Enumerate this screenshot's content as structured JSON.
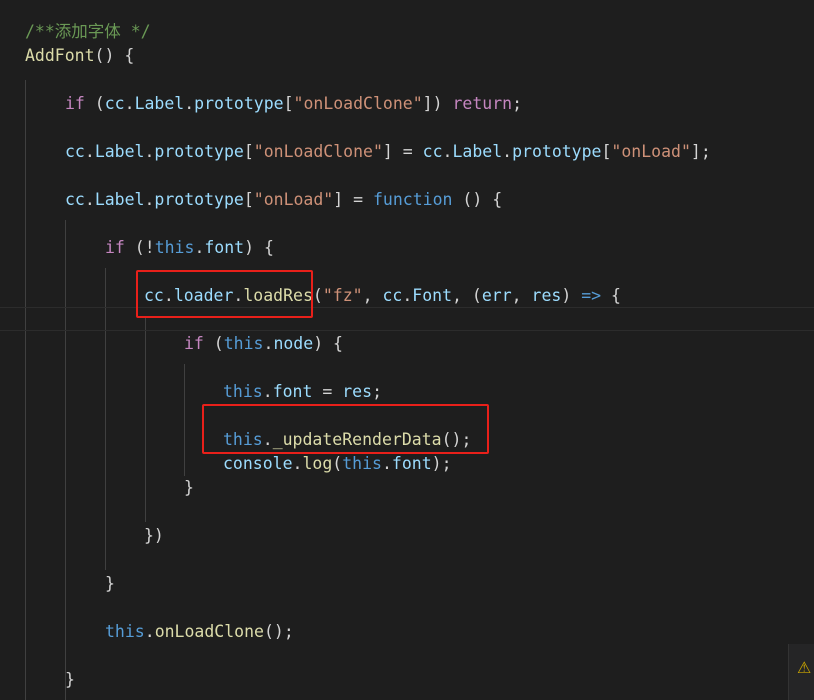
{
  "editor": {
    "lines": {
      "l1_comment": "/**添加字体 */",
      "l2_func": "AddFont",
      "l2_rest": "() {",
      "l3_if": "if",
      "l3_a": " (",
      "l3_cc": "cc",
      "l3_dot1": ".",
      "l3_label": "Label",
      "l3_dot2": ".",
      "l3_proto": "prototype",
      "l3_b": "[",
      "l3_str": "\"onLoadClone\"",
      "l3_c": "]) ",
      "l3_return": "return",
      "l3_semi": ";",
      "l4_cc": "cc",
      "l4_d1": ".",
      "l4_label": "Label",
      "l4_d2": ".",
      "l4_proto": "prototype",
      "l4_b1": "[",
      "l4_str1": "\"onLoadClone\"",
      "l4_b2": "] = ",
      "l4_cc2": "cc",
      "l4_d3": ".",
      "l4_label2": "Label",
      "l4_d4": ".",
      "l4_proto2": "prototype",
      "l4_b3": "[",
      "l4_str2": "\"onLoad\"",
      "l4_b4": "];",
      "l5_cc": "cc",
      "l5_d1": ".",
      "l5_label": "Label",
      "l5_d2": ".",
      "l5_proto": "prototype",
      "l5_b1": "[",
      "l5_str": "\"onLoad\"",
      "l5_b2": "] = ",
      "l5_function": "function",
      "l5_rest": " () {",
      "l6_if": "if",
      "l6_a": " (!",
      "l6_this": "this",
      "l6_d": ".",
      "l6_font": "font",
      "l6_b": ") {",
      "l7_cc": "cc",
      "l7_d1": ".",
      "l7_loader": "loader",
      "l7_d2": ".",
      "l7_loadres": "loadRes",
      "l7_a": "(",
      "l7_str": "\"fz\"",
      "l7_b": ", ",
      "l7_cc2": "cc",
      "l7_d3": ".",
      "l7_font": "Font",
      "l7_c": ", (",
      "l7_err": "err",
      "l7_e": ", ",
      "l7_res": "res",
      "l7_f": ") ",
      "l7_arrow": "=>",
      "l7_g": " {",
      "l8_if": "if",
      "l8_a": " (",
      "l8_this": "this",
      "l8_d": ".",
      "l8_node": "node",
      "l8_b": ") {",
      "l9_this": "this",
      "l9_d": ".",
      "l9_font": "font",
      "l9_eq": " = ",
      "l9_res": "res",
      "l9_semi": ";",
      "l10_this": "this",
      "l10_d": ".",
      "l10_upd": "_updateRenderData",
      "l10_rest": "();",
      "l11_console": "console",
      "l11_d": ".",
      "l11_log": "log",
      "l11_a": "(",
      "l11_this": "this",
      "l11_d2": ".",
      "l11_font": "font",
      "l11_b": ");",
      "l12_brace": "}",
      "l13_close": "})",
      "l14_brace": "}",
      "l15_this": "this",
      "l15_d": ".",
      "l15_onload": "onLoadClone",
      "l15_rest": "();",
      "l16_brace": "}"
    }
  },
  "status": {
    "warning_icon": "warning-icon",
    "warning_glyph": "⚠"
  },
  "colors": {
    "background": "#1e1e1e",
    "comment": "#6a9955",
    "function": "#dcdcaa",
    "keyword": "#c586c0",
    "variable": "#9cdcfe",
    "string": "#ce9178",
    "storage": "#569cd6",
    "highlight_box": "#e8201a"
  }
}
